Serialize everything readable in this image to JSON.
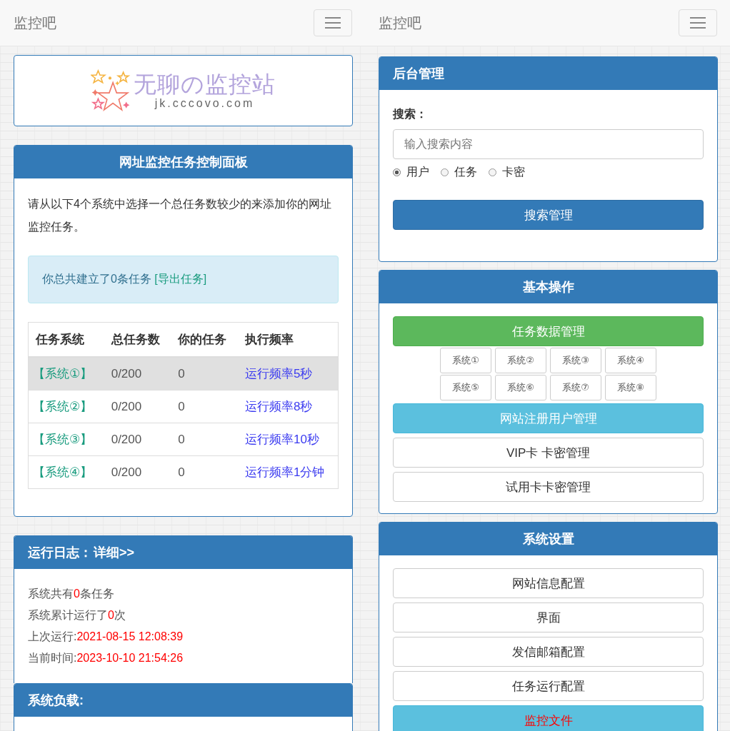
{
  "left": {
    "navbar": {
      "brand": "监控吧"
    },
    "logo": {
      "title": "无聊の监控站",
      "url": "jk.cccovo.com"
    },
    "task_panel": {
      "title": "网址监控任务控制面板",
      "intro": "请从以下4个系统中选择一个总任务数较少的来添加你的网址监控任务。",
      "notice": {
        "text": "你总共建立了0条任务 ",
        "link": "[导出任务]"
      },
      "table": {
        "columns": [
          "任务系统",
          "总任务数",
          "你的任务",
          "执行频率"
        ],
        "rows": [
          {
            "cells": [
              "【系统①】",
              "0/200",
              "0",
              "运行频率5秒"
            ],
            "highlighted": true
          },
          {
            "cells": [
              "【系统②】",
              "0/200",
              "0",
              "运行频率8秒"
            ],
            "highlighted": false
          },
          {
            "cells": [
              "【系统③】",
              "0/200",
              "0",
              "运行频率10秒"
            ],
            "highlighted": false
          },
          {
            "cells": [
              "【系统④】",
              "0/200",
              "0",
              "运行频率1分钟"
            ],
            "highlighted": false
          }
        ]
      }
    },
    "log_panel": {
      "title": "运行日志：",
      "link": "详细>>",
      "lines": [
        {
          "label": "系统共有",
          "value": "0",
          "suffix": "条任务"
        },
        {
          "label": "系统累计运行了",
          "value": "0",
          "suffix": "次"
        },
        {
          "label": "上次运行:",
          "value": "2021-08-15 12:08:39"
        },
        {
          "label": "当前时间:",
          "value": "2023-10-10 21:54:26"
        }
      ]
    },
    "load_panel": {
      "title": "系统负载:"
    }
  },
  "right": {
    "navbar": {
      "brand": "监控吧"
    },
    "admin_panel": {
      "title": "后台管理",
      "search_label": "搜索：",
      "search_placeholder": "输入搜索内容",
      "radios": [
        {
          "label": "用户",
          "selected": true
        },
        {
          "label": "任务",
          "selected": false
        },
        {
          "label": "卡密",
          "selected": false
        }
      ],
      "button": "搜索管理"
    },
    "basic_panel": {
      "title": "基本操作",
      "items": [
        {
          "kind": "success_button",
          "label": "任务数据管理"
        },
        {
          "kind": "grid",
          "labels": [
            "系统①",
            "系统②",
            "系统③",
            "系统④",
            "系统⑤",
            "系统⑥",
            "系统⑦",
            "系统⑧"
          ]
        },
        {
          "kind": "info_button",
          "label": "网站注册用户管理"
        },
        {
          "kind": "default_button",
          "label": "VIP卡 卡密管理"
        },
        {
          "kind": "default_button",
          "label": "试用卡卡密管理"
        }
      ]
    },
    "settings_panel": {
      "title": "系统设置",
      "items": [
        {
          "kind": "default_button",
          "label": "网站信息配置",
          "alert": false
        },
        {
          "kind": "default_button",
          "label": "界面",
          "alert": false
        },
        {
          "kind": "default_button",
          "label": "发信邮箱配置",
          "alert": false
        },
        {
          "kind": "default_button",
          "label": "任务运行配置",
          "alert": false
        },
        {
          "kind": "info_button",
          "label": "监控文件",
          "alert": true
        }
      ]
    }
  }
}
